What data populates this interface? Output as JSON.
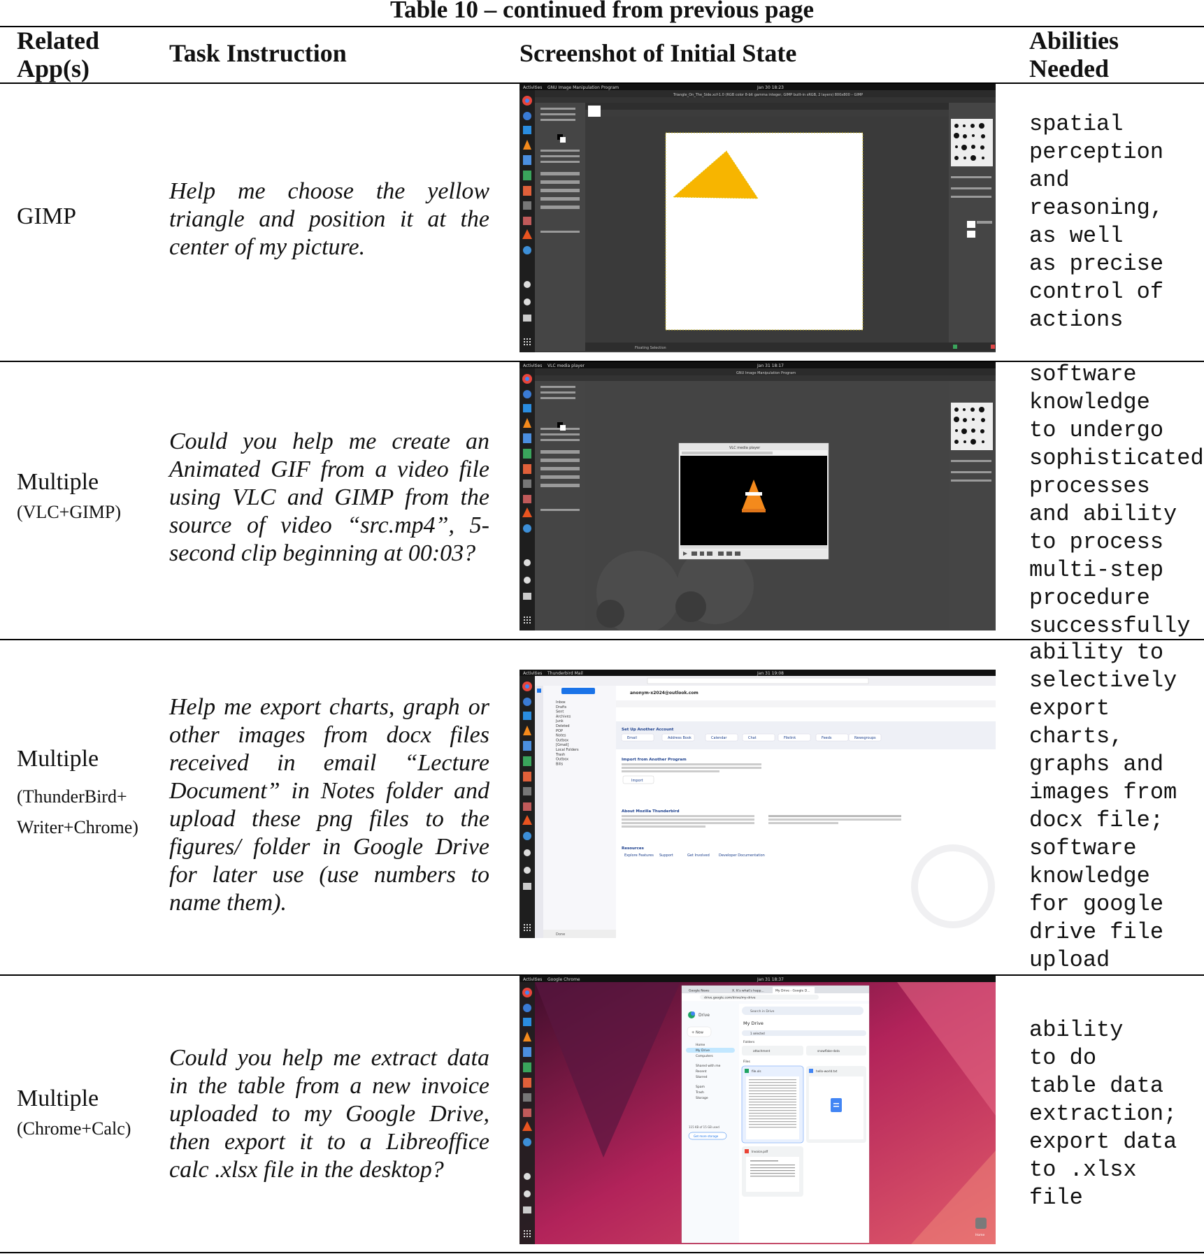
{
  "caption": "Table 10 – continued from previous page",
  "headers": {
    "apps_line1": "Related",
    "apps_line2": "App(s)",
    "task": "Task Instruction",
    "screenshot": "Screenshot of Initial State",
    "abilities_line1": "Abilities",
    "abilities_line2": "Needed"
  },
  "rows": [
    {
      "app": "GIMP",
      "app_sub": "",
      "instruction": "Help me choose the yellow triangle and position it at the center of my picture.",
      "abilities": "spatial\nperception\nand\nreasoning,\nas well\nas precise\ncontrol of\nactions",
      "screen": {
        "topbar_left": "Activities",
        "topbar_app": "GNU Image Manipulation Program",
        "topbar_time": "Jan 30 18:23",
        "window_title": "Triangle_On_The_Side.xcf-1.0 (RGB color 8-bit gamma integer, GIMP built-in sRGB, 2 layers) 800x800 – GIMP",
        "status": "Floating Selection"
      }
    },
    {
      "app": "Multiple",
      "app_sub": "(VLC+GIMP)",
      "instruction": "Could you help me create an Animated GIF from a video file using VLC and GIMP from the source of video “src.mp4”, 5-second clip beginning at 00:03?",
      "abilities": "software\nknowledge\nto undergo\nsophisticated\nprocesses\nand ability\nto process\nmulti-step\nprocedure\nsuccessfully",
      "screen": {
        "topbar_left": "Activities",
        "topbar_app": "VLC media player",
        "topbar_time": "Jan 31 18:17",
        "window_title": "GNU Image Manipulation Program",
        "dialog_title": "VLC media player"
      }
    },
    {
      "app": "Multiple",
      "app_sub": "(ThunderBird+ Writer+Chrome)",
      "instruction": "Help me export charts, graph or other images from docx files received in email “Lecture Document” in Notes folder and upload these png files to the figures/ folder in Google Drive for later use (use numbers to name them).",
      "abilities": "ability to\nselectively\nexport\ncharts,\ngraphs and\nimages from\ndocx file;\nsoftware\nknowledge\nfor google\ndrive file\nupload",
      "screen": {
        "topbar_left": "Activities",
        "topbar_app": "Thunderbird Mail",
        "topbar_time": "Jan 31 19:08",
        "account": "anonym-x2024@outlook.com",
        "folders": [
          "Inbox",
          "Drafts",
          "Sent",
          "Archives",
          "Junk",
          "Deleted",
          "POP",
          "Notes",
          "Outbox",
          "[Gmail]",
          "Local Folders",
          "Trash",
          "Outbox",
          "Bills"
        ],
        "setup_heading": "Set Up Another Account",
        "setup_buttons": [
          "Email",
          "Address Book",
          "Calendar",
          "Chat",
          "Filelink",
          "Feeds",
          "Newsgroups"
        ],
        "import_heading": "Import from Another Program",
        "import_button": "Import",
        "about_heading": "About Mozilla Thunderbird",
        "resources_heading": "Resources",
        "resources_links": [
          "Explore Features",
          "Support",
          "Get Involved",
          "Developer Documentation"
        ],
        "status": "Done"
      }
    },
    {
      "app": "Multiple",
      "app_sub": "(Chrome+Calc)",
      "instruction": "Could you help me extract data in the table from a new invoice uploaded to my Google Drive, then export it to a Libreoffice calc .xlsx file in the desktop?",
      "abilities": "ability\nto do\ntable data\nextraction;\nexport data\nto .xlsx\nfile",
      "screen": {
        "topbar_left": "Activities",
        "topbar_app": "Google Chrome",
        "topbar_time": "Jan 31 18:37",
        "tabs": [
          "Google News",
          "X. It's what's happ...",
          "My Drive - Google D..."
        ],
        "url": "drive.google.com/drive/my-drive",
        "drive_label": "Drive",
        "search_placeholder": "Search in Drive",
        "new_button": "New",
        "nav": [
          "Home",
          "My Drive",
          "Computers",
          "Shared with me",
          "Recent",
          "Starred",
          "Spam",
          "Trash",
          "Storage"
        ],
        "storage_text": "115 KB of 15 GB used",
        "storage_button": "Get more storage",
        "heading": "My Drive",
        "selected": "1 selected",
        "folders_label": "Folders",
        "folders": [
          "attachment",
          "snowflake-data"
        ],
        "files_label": "Files",
        "files": [
          "file.xls",
          "hello-world.txt",
          "Invoice.pdf"
        ],
        "desktop_icon": "Home"
      }
    }
  ]
}
